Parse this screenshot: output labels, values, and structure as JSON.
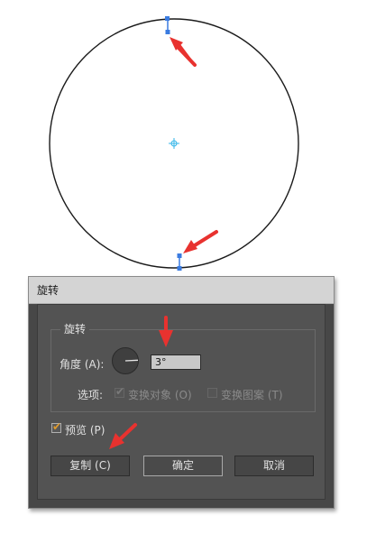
{
  "dialog": {
    "title": "旋转",
    "group_title": "旋转",
    "angle_label": "角度 (A):",
    "angle_value": "3°",
    "options_label": "选项:",
    "transform_objects_label": "变换对象 (O)",
    "transform_patterns_label": "变换图案 (T)",
    "preview_label": "预览 (P)",
    "copy_button": "复制 (C)",
    "ok_button": "确定",
    "cancel_button": "取消"
  },
  "colors": {
    "annotation_arrow": "#e8322f",
    "anchor_point": "#3a7be0",
    "center_marker": "#33b6e8",
    "checkbox_accent": "#e09b2d"
  }
}
